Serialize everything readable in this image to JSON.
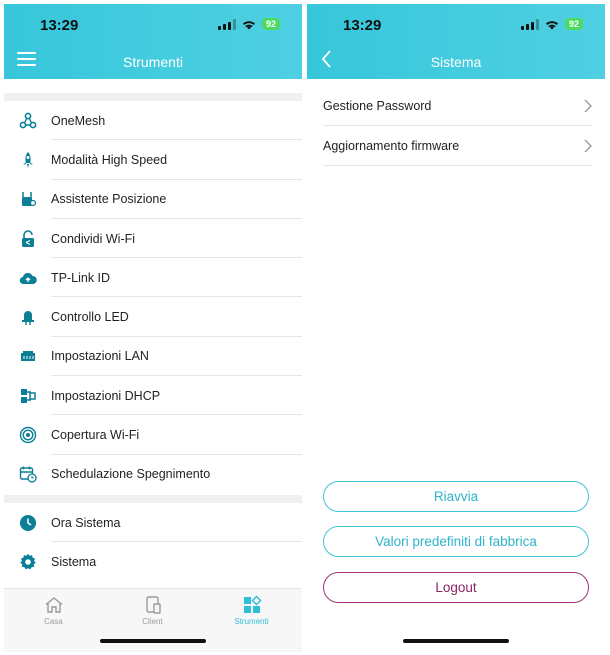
{
  "status": {
    "time": "13:29",
    "battery": "92"
  },
  "left": {
    "title": "Strumenti",
    "items": [
      {
        "label": "OneMesh",
        "icon": "mesh-icon"
      },
      {
        "label": "Modalità High Speed",
        "icon": "rocket-icon"
      },
      {
        "label": "Assistente Posizione",
        "icon": "location-router-icon"
      },
      {
        "label": "Condividi Wi-Fi",
        "icon": "share-lock-icon"
      },
      {
        "label": "TP-Link ID",
        "icon": "cloud-icon"
      },
      {
        "label": "Controllo LED",
        "icon": "led-icon"
      },
      {
        "label": "Impostazioni LAN",
        "icon": "lan-icon"
      },
      {
        "label": "Impostazioni DHCP",
        "icon": "dhcp-icon"
      },
      {
        "label": "Copertura Wi-Fi",
        "icon": "coverage-icon"
      },
      {
        "label": "Schedulazione Spegnimento",
        "icon": "schedule-icon"
      }
    ],
    "items2": [
      {
        "label": "Ora Sistema",
        "icon": "clock-icon"
      },
      {
        "label": "Sistema",
        "icon": "gear-icon"
      }
    ],
    "tabs": [
      {
        "label": "Casa",
        "icon": "home-icon"
      },
      {
        "label": "Client",
        "icon": "devices-icon"
      },
      {
        "label": "Strumenti",
        "icon": "tools-icon"
      }
    ],
    "active_tab": "Strumenti"
  },
  "right": {
    "title": "Sistema",
    "rows": [
      {
        "label": "Gestione Password"
      },
      {
        "label": "Aggiornamento firmware"
      }
    ],
    "buttons": {
      "reboot": "Riavvia",
      "factory": "Valori predefiniti di fabbrica",
      "logout": "Logout"
    }
  },
  "colors": {
    "accent": "#2fbfd6",
    "header": "#44cadd",
    "logout": "#8a2467"
  }
}
